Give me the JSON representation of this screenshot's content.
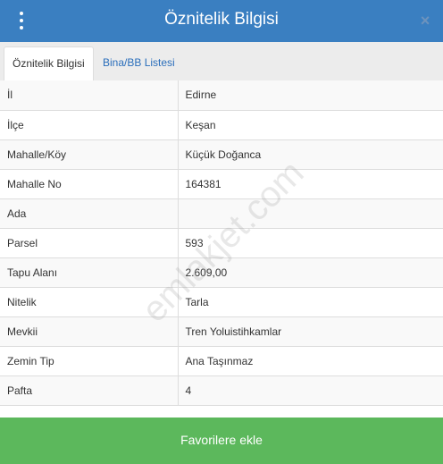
{
  "header": {
    "title": "Öznitelik Bilgisi",
    "close_symbol": "×",
    "menu_icon": "vertical-dots-icon",
    "close_icon": "close-icon"
  },
  "tabs": [
    {
      "label": "Öznitelik Bilgisi",
      "active": true
    },
    {
      "label": "Bina/BB Listesi",
      "active": false
    }
  ],
  "attributes": [
    {
      "label": "İl",
      "value": "Edirne"
    },
    {
      "label": "İlçe",
      "value": "Keşan"
    },
    {
      "label": "Mahalle/Köy",
      "value": "Küçük Doğanca"
    },
    {
      "label": "Mahalle No",
      "value": "164381"
    },
    {
      "label": "Ada",
      "value": ""
    },
    {
      "label": "Parsel",
      "value": "593"
    },
    {
      "label": "Tapu Alanı",
      "value": "2.609,00"
    },
    {
      "label": "Nitelik",
      "value": "Tarla"
    },
    {
      "label": "Mevkii",
      "value": "Tren Yoluistihkamlar"
    },
    {
      "label": "Zemin Tip",
      "value": "Ana Taşınmaz"
    },
    {
      "label": "Pafta",
      "value": "4"
    }
  ],
  "watermark": "emlakjet.com",
  "footer": {
    "button_label": "Favorilere ekle"
  },
  "colors": {
    "header_bg": "#3a7fc1",
    "button_bg": "#5cb85c",
    "link": "#2a6ebb"
  }
}
